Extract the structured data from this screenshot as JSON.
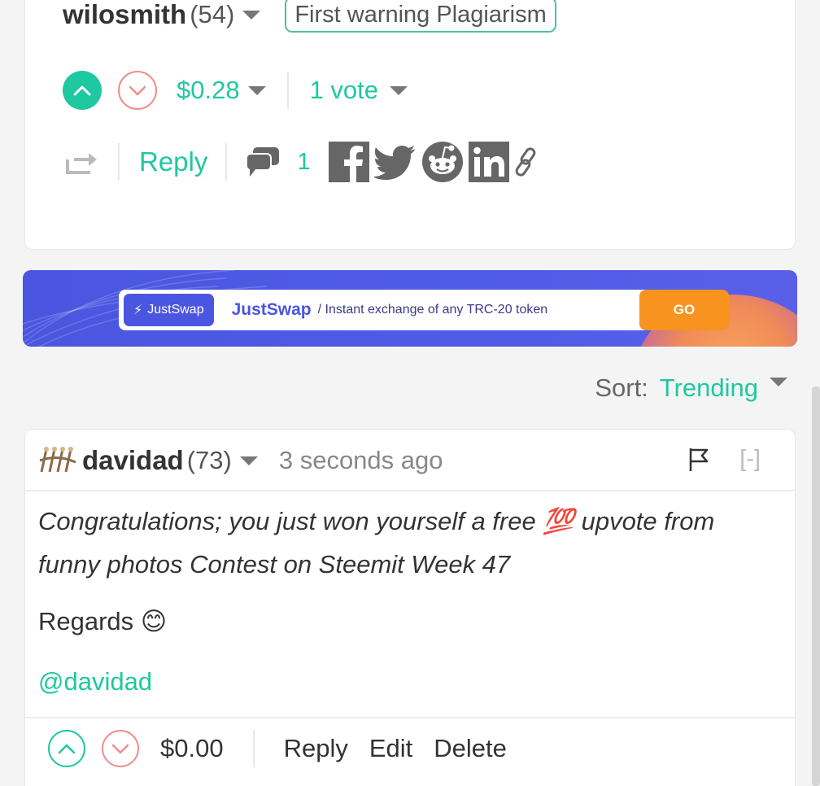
{
  "top_comment": {
    "author": "wilosmith",
    "reputation": "(54)",
    "tag": "First warning Plagiarism",
    "payout": "$0.28",
    "votes": "1 vote",
    "reply_label": "Reply",
    "reply_count": "1",
    "share_icons": [
      "facebook-icon",
      "twitter-icon",
      "reddit-icon",
      "linkedin-icon",
      "link-icon"
    ]
  },
  "ad": {
    "logo_text": "JustSwap",
    "title": "JustSwap",
    "subtitle": "/ Instant exchange of any TRC-20 token",
    "cta": "GO"
  },
  "sort": {
    "label": "Sort:",
    "value": "Trending"
  },
  "comment": {
    "author": "davidad",
    "reputation": "(73)",
    "time": "3 seconds ago",
    "collapse": "[-]",
    "body_line1": "Congratulations; you just won yourself a free",
    "emoji_100": "💯",
    "body_line1b": " upvote from",
    "body_line2": "funny photos Contest on Steemit Week 47",
    "regards": "Regards",
    "smile_emoji": "😊",
    "mention": "@davidad",
    "payout": "$0.00",
    "actions": {
      "reply": "Reply",
      "edit": "Edit",
      "delete": "Delete"
    }
  },
  "colors": {
    "accent": "#1ec8a0",
    "downvote": "#f08d8d",
    "ad_bg": "#4a56e0",
    "ad_cta": "#f7931e"
  }
}
